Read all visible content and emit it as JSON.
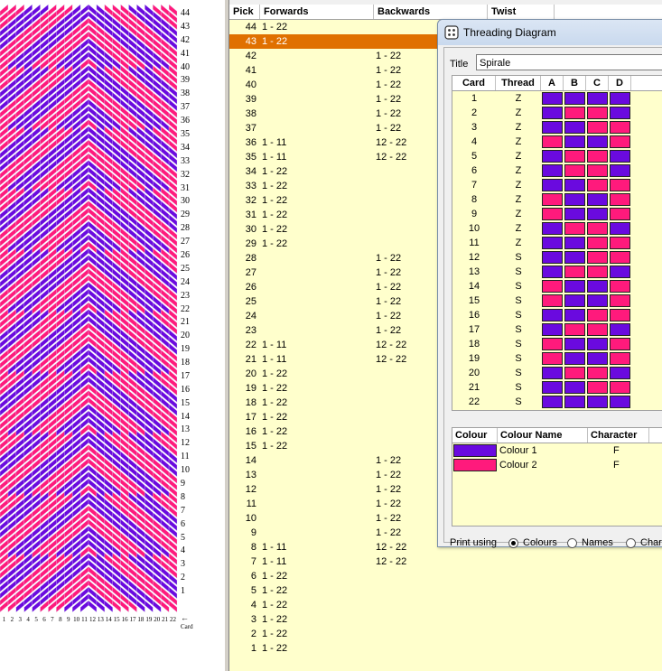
{
  "pattern": {
    "colour1": "#6a0adf",
    "colour2": "#ff1a7c",
    "picks_shown": [
      "44",
      "43",
      "42",
      "41",
      "40",
      "39",
      "38",
      "37",
      "36",
      "35",
      "34",
      "33",
      "32",
      "31",
      "30",
      "29",
      "28",
      "27",
      "26",
      "25",
      "24",
      "23",
      "22",
      "21",
      "20",
      "19",
      "18",
      "17",
      "16",
      "15",
      "14",
      "13",
      "12",
      "11",
      "10",
      "9",
      "8",
      "7",
      "6",
      "5",
      "4",
      "3",
      "2",
      "1"
    ],
    "cards_shown": [
      "1",
      "2",
      "3",
      "4",
      "5",
      "6",
      "7",
      "8",
      "9",
      "10",
      "11",
      "12",
      "13",
      "14",
      "15",
      "16",
      "17",
      "18",
      "19",
      "20",
      "21",
      "22"
    ],
    "card_axis_label": "Card"
  },
  "table": {
    "headers": {
      "pick": "Pick",
      "forwards": "Forwards",
      "backwards": "Backwards",
      "twist": "Twist"
    },
    "selected_pick": "43",
    "rows": [
      {
        "pick": "44",
        "forwards": "1 - 22",
        "backwards": ""
      },
      {
        "pick": "43",
        "forwards": "1 - 22",
        "backwards": ""
      },
      {
        "pick": "42",
        "forwards": "",
        "backwards": "1 - 22"
      },
      {
        "pick": "41",
        "forwards": "",
        "backwards": "1 - 22"
      },
      {
        "pick": "40",
        "forwards": "",
        "backwards": "1 - 22"
      },
      {
        "pick": "39",
        "forwards": "",
        "backwards": "1 - 22"
      },
      {
        "pick": "38",
        "forwards": "",
        "backwards": "1 - 22"
      },
      {
        "pick": "37",
        "forwards": "",
        "backwards": "1 - 22"
      },
      {
        "pick": "36",
        "forwards": "1 - 11",
        "backwards": "12 - 22"
      },
      {
        "pick": "35",
        "forwards": "1 - 11",
        "backwards": "12 - 22"
      },
      {
        "pick": "34",
        "forwards": "1 - 22",
        "backwards": ""
      },
      {
        "pick": "33",
        "forwards": "1 - 22",
        "backwards": ""
      },
      {
        "pick": "32",
        "forwards": "1 - 22",
        "backwards": ""
      },
      {
        "pick": "31",
        "forwards": "1 - 22",
        "backwards": ""
      },
      {
        "pick": "30",
        "forwards": "1 - 22",
        "backwards": ""
      },
      {
        "pick": "29",
        "forwards": "1 - 22",
        "backwards": ""
      },
      {
        "pick": "28",
        "forwards": "",
        "backwards": "1 - 22"
      },
      {
        "pick": "27",
        "forwards": "",
        "backwards": "1 - 22"
      },
      {
        "pick": "26",
        "forwards": "",
        "backwards": "1 - 22"
      },
      {
        "pick": "25",
        "forwards": "",
        "backwards": "1 - 22"
      },
      {
        "pick": "24",
        "forwards": "",
        "backwards": "1 - 22"
      },
      {
        "pick": "23",
        "forwards": "",
        "backwards": "1 - 22"
      },
      {
        "pick": "22",
        "forwards": "1 - 11",
        "backwards": "12 - 22"
      },
      {
        "pick": "21",
        "forwards": "1 - 11",
        "backwards": "12 - 22"
      },
      {
        "pick": "20",
        "forwards": "1 - 22",
        "backwards": ""
      },
      {
        "pick": "19",
        "forwards": "1 - 22",
        "backwards": ""
      },
      {
        "pick": "18",
        "forwards": "1 - 22",
        "backwards": ""
      },
      {
        "pick": "17",
        "forwards": "1 - 22",
        "backwards": ""
      },
      {
        "pick": "16",
        "forwards": "1 - 22",
        "backwards": ""
      },
      {
        "pick": "15",
        "forwards": "1 - 22",
        "backwards": ""
      },
      {
        "pick": "14",
        "forwards": "",
        "backwards": "1 - 22"
      },
      {
        "pick": "13",
        "forwards": "",
        "backwards": "1 - 22"
      },
      {
        "pick": "12",
        "forwards": "",
        "backwards": "1 - 22"
      },
      {
        "pick": "11",
        "forwards": "",
        "backwards": "1 - 22"
      },
      {
        "pick": "10",
        "forwards": "",
        "backwards": "1 - 22"
      },
      {
        "pick": "9",
        "forwards": "",
        "backwards": "1 - 22"
      },
      {
        "pick": "8",
        "forwards": "1 - 11",
        "backwards": "12 - 22"
      },
      {
        "pick": "7",
        "forwards": "1 - 11",
        "backwards": "12 - 22"
      },
      {
        "pick": "6",
        "forwards": "1 - 22",
        "backwards": ""
      },
      {
        "pick": "5",
        "forwards": "1 - 22",
        "backwards": ""
      },
      {
        "pick": "4",
        "forwards": "1 - 22",
        "backwards": ""
      },
      {
        "pick": "3",
        "forwards": "1 - 22",
        "backwards": ""
      },
      {
        "pick": "2",
        "forwards": "1 - 22",
        "backwards": ""
      },
      {
        "pick": "1",
        "forwards": "1 - 22",
        "backwards": ""
      }
    ]
  },
  "dialog": {
    "title": "Threading Diagram",
    "title_label": "Title",
    "title_value": "Spirale",
    "grid_headers": {
      "card": "Card",
      "thread": "Thread",
      "a": "A",
      "b": "B",
      "c": "C",
      "d": "D"
    },
    "cards": [
      {
        "card": "1",
        "thread": "Z",
        "holes": [
          1,
          1,
          1,
          1
        ]
      },
      {
        "card": "2",
        "thread": "Z",
        "holes": [
          1,
          2,
          2,
          1
        ]
      },
      {
        "card": "3",
        "thread": "Z",
        "holes": [
          1,
          1,
          2,
          2
        ]
      },
      {
        "card": "4",
        "thread": "Z",
        "holes": [
          2,
          1,
          1,
          2
        ]
      },
      {
        "card": "5",
        "thread": "Z",
        "holes": [
          1,
          2,
          2,
          1
        ]
      },
      {
        "card": "6",
        "thread": "Z",
        "holes": [
          1,
          2,
          2,
          1
        ]
      },
      {
        "card": "7",
        "thread": "Z",
        "holes": [
          1,
          1,
          2,
          2
        ]
      },
      {
        "card": "8",
        "thread": "Z",
        "holes": [
          2,
          1,
          1,
          2
        ]
      },
      {
        "card": "9",
        "thread": "Z",
        "holes": [
          2,
          1,
          1,
          2
        ]
      },
      {
        "card": "10",
        "thread": "Z",
        "holes": [
          1,
          2,
          2,
          1
        ]
      },
      {
        "card": "11",
        "thread": "Z",
        "holes": [
          1,
          1,
          2,
          2
        ]
      },
      {
        "card": "12",
        "thread": "S",
        "holes": [
          1,
          1,
          2,
          2
        ]
      },
      {
        "card": "13",
        "thread": "S",
        "holes": [
          1,
          2,
          2,
          1
        ]
      },
      {
        "card": "14",
        "thread": "S",
        "holes": [
          2,
          1,
          1,
          2
        ]
      },
      {
        "card": "15",
        "thread": "S",
        "holes": [
          2,
          1,
          1,
          2
        ]
      },
      {
        "card": "16",
        "thread": "S",
        "holes": [
          1,
          1,
          2,
          2
        ]
      },
      {
        "card": "17",
        "thread": "S",
        "holes": [
          1,
          2,
          2,
          1
        ]
      },
      {
        "card": "18",
        "thread": "S",
        "holes": [
          2,
          1,
          1,
          2
        ]
      },
      {
        "card": "19",
        "thread": "S",
        "holes": [
          2,
          1,
          1,
          2
        ]
      },
      {
        "card": "20",
        "thread": "S",
        "holes": [
          1,
          2,
          2,
          1
        ]
      },
      {
        "card": "21",
        "thread": "S",
        "holes": [
          1,
          1,
          2,
          2
        ]
      },
      {
        "card": "22",
        "thread": "S",
        "holes": [
          1,
          1,
          1,
          1
        ]
      }
    ],
    "colour_headers": {
      "colour": "Colour",
      "name": "Colour Name",
      "character": "Character"
    },
    "colours": [
      {
        "hex": "#6a0adf",
        "name": "Colour 1",
        "character": "F"
      },
      {
        "hex": "#ff1a7c",
        "name": "Colour 2",
        "character": "F"
      }
    ],
    "print_using_label": "Print using",
    "print_options": [
      "Colours",
      "Names",
      "Chara"
    ],
    "print_selected": "Colours"
  }
}
